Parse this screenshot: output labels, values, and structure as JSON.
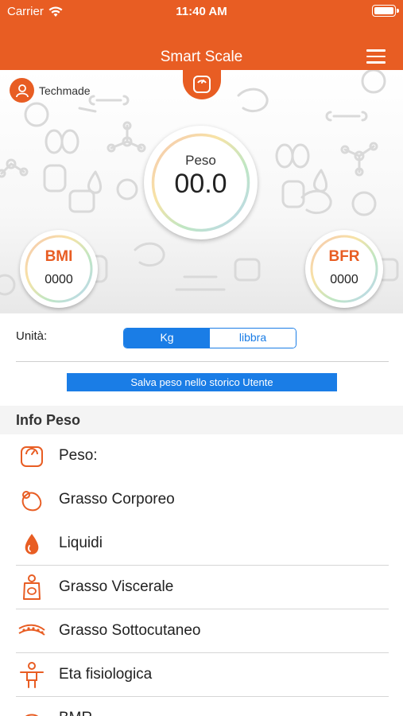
{
  "status_bar": {
    "carrier": "Carrier",
    "time": "11:40 AM"
  },
  "nav": {
    "title": "Smart Scale"
  },
  "user": {
    "name": "Techmade"
  },
  "gauges": {
    "main": {
      "label": "Peso",
      "value": "00.0"
    },
    "bmi": {
      "label": "BMI",
      "value": "0000"
    },
    "bfr": {
      "label": "BFR",
      "value": "0000"
    }
  },
  "units": {
    "label": "Unità:",
    "options": [
      "Kg",
      "libbra"
    ],
    "selected": "Kg"
  },
  "save_button": {
    "label": "Salva peso nello storico Utente"
  },
  "info": {
    "title": "Info Peso",
    "items": [
      {
        "label": "Peso:",
        "icon": "scale-icon"
      },
      {
        "label": "Grasso Corporeo",
        "icon": "fat-icon"
      },
      {
        "label": "Liquidi",
        "icon": "water-drop-icon"
      },
      {
        "label": "Grasso Viscerale",
        "icon": "body-torso-icon"
      },
      {
        "label": "Grasso Sottocutaneo",
        "icon": "skin-layer-icon"
      },
      {
        "label": "Eta fisiologica",
        "icon": "person-age-icon"
      },
      {
        "label": "BMR",
        "icon": "metabolism-icon"
      }
    ]
  },
  "colors": {
    "accent": "#e85d23",
    "blue": "#1a7de6"
  }
}
